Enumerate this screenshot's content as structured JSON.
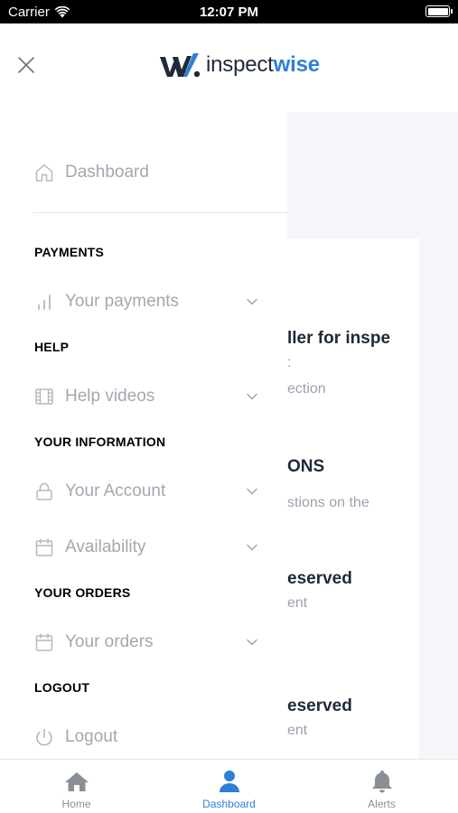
{
  "status_bar": {
    "carrier": "Carrier",
    "time": "12:07 PM"
  },
  "header": {
    "logo_text_part1": "inspect",
    "logo_text_part2": "wise",
    "brand_color": "#2f7fd6"
  },
  "drawer": {
    "dashboard_label": "Dashboard",
    "sections": {
      "payments": "PAYMENTS",
      "help": "HELP",
      "your_information": "YOUR INFORMATION",
      "your_orders": "YOUR ORDERS",
      "logout": "LOGOUT"
    },
    "items": {
      "your_payments": "Your payments",
      "help_videos": "Help videos",
      "your_account": "Your Account",
      "availability": "Availability",
      "your_orders": "Your orders",
      "logout": "Logout"
    }
  },
  "background_page": {
    "line1": "ller for inspe",
    "line2": ":",
    "line3": "ection",
    "line4": "ONS",
    "line5": "stions on the",
    "line6": "eserved",
    "line7": "ent",
    "line8": "eserved",
    "line9": "ent"
  },
  "tab_bar": {
    "home": "Home",
    "dashboard": "Dashboard",
    "alerts": "Alerts",
    "active_tab": "Dashboard"
  }
}
